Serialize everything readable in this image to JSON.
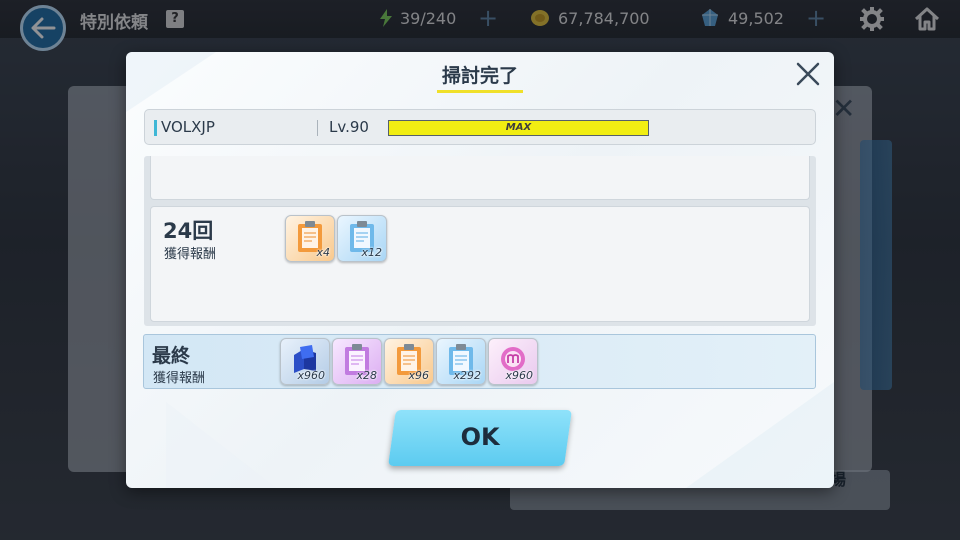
{
  "header": {
    "page_title": "特別依頼",
    "help_icon_label": "?",
    "stamina": "39/240",
    "credits": "67,784,700",
    "gems": "49,502"
  },
  "background": {
    "bottom_button_fragment": "場"
  },
  "dialog": {
    "title": "掃討完了",
    "player": {
      "name": "VOLXJP",
      "level": "Lv.90",
      "exp_label": "MAX",
      "exp_fill": 1.0
    },
    "runs": [
      {
        "count": "24回",
        "caption": "獲得報酬",
        "rewards": [
          {
            "icon": "orange-report-icon",
            "qty": "x4"
          },
          {
            "icon": "blue-report-icon",
            "qty": "x12"
          }
        ]
      }
    ],
    "final": {
      "title": "最終",
      "caption": "獲得報酬",
      "rewards": [
        {
          "icon": "blue-crystal-icon",
          "qty": "x960"
        },
        {
          "icon": "purple-report-icon",
          "qty": "x28"
        },
        {
          "icon": "orange-report-icon",
          "qty": "x96"
        },
        {
          "icon": "blue-report-icon",
          "qty": "x292"
        },
        {
          "icon": "pink-bond-icon",
          "qty": "x960"
        }
      ]
    },
    "ok_label": "OK"
  },
  "colors": {
    "accent_yellow": "#f0e02a",
    "ok_button": "#6fd6f4",
    "exp_bar": "#f1ee12",
    "report_orange": "#f39a3c",
    "report_blue": "#6fb9ea",
    "report_purple": "#c17be0"
  }
}
